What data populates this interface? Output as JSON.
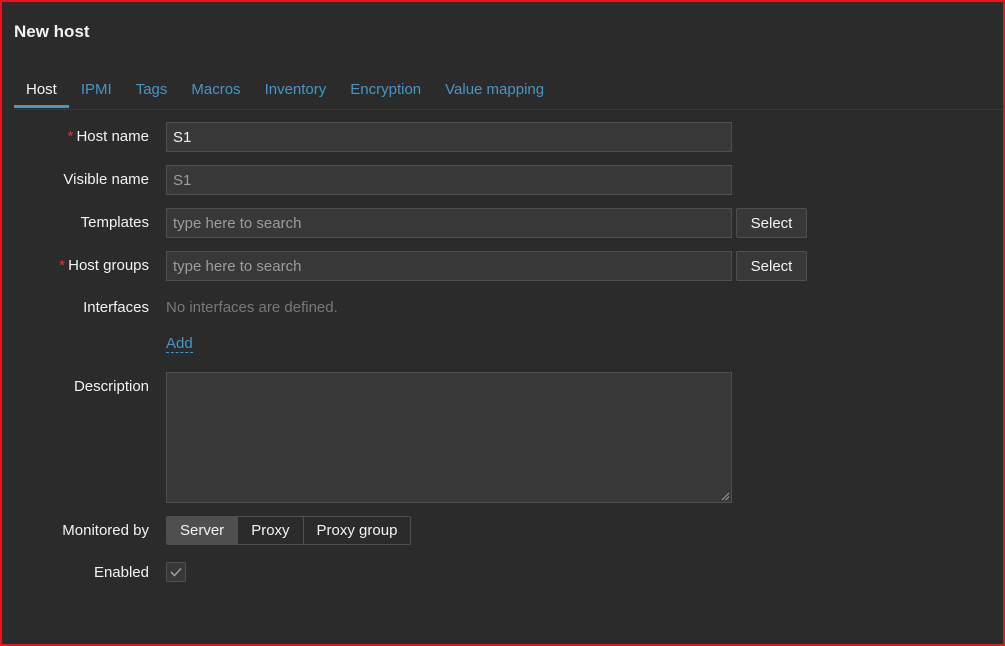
{
  "page": {
    "title": "New host"
  },
  "tabs": [
    {
      "label": "Host",
      "active": true
    },
    {
      "label": "IPMI"
    },
    {
      "label": "Tags"
    },
    {
      "label": "Macros"
    },
    {
      "label": "Inventory"
    },
    {
      "label": "Encryption"
    },
    {
      "label": "Value mapping"
    }
  ],
  "form": {
    "host_name": {
      "label": "Host name",
      "required_mark": "*",
      "value": "S1"
    },
    "visible_name": {
      "label": "Visible name",
      "placeholder": "S1"
    },
    "templates": {
      "label": "Templates",
      "placeholder": "type here to search",
      "button": "Select"
    },
    "host_groups": {
      "label": "Host groups",
      "required_mark": "*",
      "placeholder": "type here to search",
      "button": "Select"
    },
    "interfaces": {
      "label": "Interfaces",
      "empty_text": "No interfaces are defined.",
      "add_link": "Add"
    },
    "description": {
      "label": "Description",
      "value": ""
    },
    "monitored_by": {
      "label": "Monitored by",
      "options": [
        "Server",
        "Proxy",
        "Proxy group"
      ],
      "selected": "Server"
    },
    "enabled": {
      "label": "Enabled",
      "checked": true
    }
  },
  "colors": {
    "background": "#2b2b2b",
    "accent": "#4796c4",
    "required": "#e33734",
    "frame_border": "#e0181b"
  }
}
